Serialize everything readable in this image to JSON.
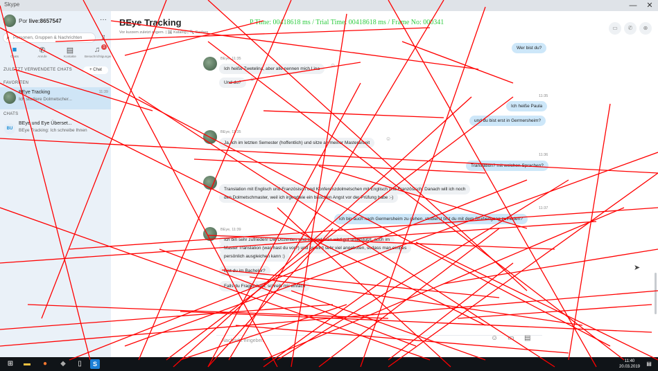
{
  "window": {
    "title": "Skype",
    "minimize": "—",
    "close": "✕"
  },
  "overlay_text": "P Time: 00418618 ms / Trial Time: 00418618 ms / Frame No: 000341",
  "sidebar": {
    "profile_name_prefix": "Por ",
    "profile_name": "live:8657547",
    "more": "···",
    "search_placeholder": "Personen, Gruppen & Nachrichten",
    "nav_tabs": [
      {
        "label": "Chats",
        "icon": "chat-icon"
      },
      {
        "label": "Anrufe",
        "icon": "phone-icon"
      },
      {
        "label": "Kontakte",
        "icon": "contacts-icon"
      },
      {
        "label": "Benachrichtigungen",
        "icon": "bell-icon",
        "badge": "1"
      }
    ],
    "recent_header": "ZULETZT VERWENDETE CHATS",
    "chat_button": "+ Chat",
    "favorites_header": "FAVORITEN",
    "chats_header": "CHATS",
    "conversations": [
      {
        "name": "BEye Tracking",
        "preview": "Ich studiere Dolmetscher...",
        "time": "11:39",
        "active": true
      },
      {
        "name": "BEye und Eye Überset...",
        "preview": "BEye Tracking: Ich schreibe Ihnen",
        "initials": "BU"
      }
    ]
  },
  "chat": {
    "title": "BEye Tracking",
    "subtitle": "Vor kurzem zuletzt angem. | 🖼 Katalog | 🔍 Suchen",
    "messages_out": [
      {
        "text": "Wer bist du?"
      },
      {
        "text": "Ich heiße Paula"
      },
      {
        "text": "und du bist erst in Germersheim?"
      },
      {
        "text": "Translation? mit welchen Sprachen?"
      },
      {
        "text": "ich bin auch nach Germersheim zu gehen. studierst bist du mit dem Studiengang zufrieden?"
      }
    ],
    "times_out": [
      "11:35",
      "11:36",
      "11:37"
    ],
    "senders": [
      "BEye, 11:35",
      "BEye, 11:35",
      "BEye, 11:39"
    ],
    "messages_in": [
      {
        "text": "Ich heiße Zwetelina, aber alle nennen mich Lina"
      },
      {
        "text": "Und du?"
      },
      {
        "text": "Ja, ich im letzten Semester (hoffentlich) und sitze an meiner Masterarbeit"
      },
      {
        "text": "Translation mit Englisch und Französisch und Konferenzdolmetschen mit Englisch und Französisch. Danach will ich noch"
      },
      {
        "text": "den Dolmetschmaster, weil ich irgendwie ein bisschen Angst vor der Prüfung habe :-)"
      },
      {
        "text": "Ich bin sehr zufrieden! Die Dozenten sind toll und man wird gut unterstützt, auch im"
      },
      {
        "text": "Master Translation (was hast du vor?) und es wird sehr viel angeboten, sodass man einiges"
      },
      {
        "text": "persönlich ausgleichen kann :)"
      },
      {
        "text": "Bist du im Bachelor?"
      },
      {
        "text": "Falls du Fragen hast, schreib mir einfach"
      }
    ],
    "composer_placeholder": "Nachricht eingeben",
    "header_buttons": [
      "video-icon",
      "phone-icon",
      "add-person-icon"
    ]
  },
  "taskbar": {
    "time": "11:40",
    "date": "20.03.2019"
  },
  "colors": {
    "accent": "#1c8fd6",
    "overlay_green": "#2ecc40",
    "scribble_red": "#ff0000"
  }
}
